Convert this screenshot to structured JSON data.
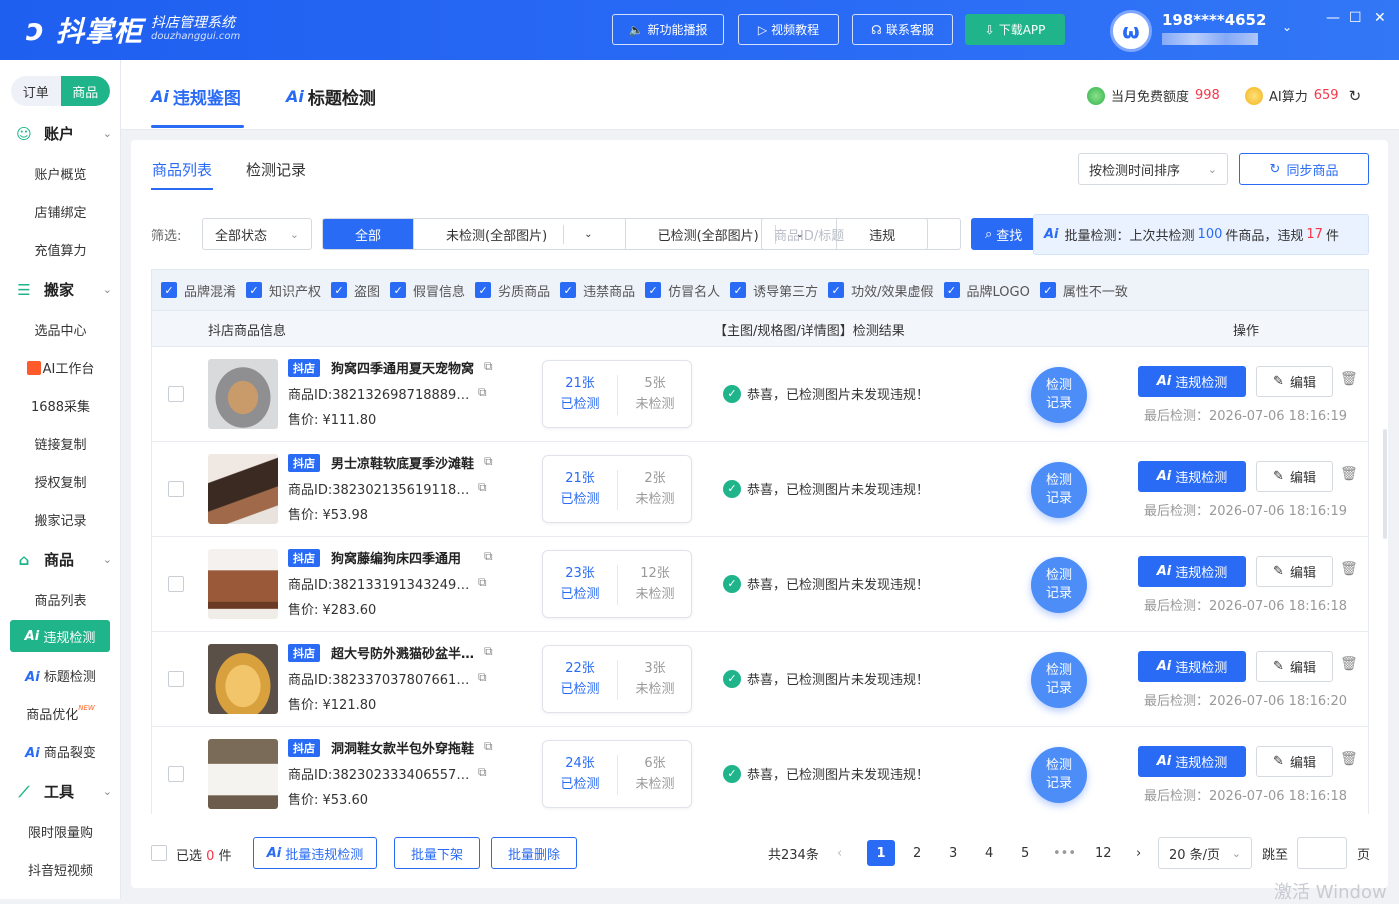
{
  "header": {
    "logo_name": "抖掌柜",
    "logo_sub": "抖店管理系统",
    "logo_domain": "douzhanggui.com",
    "buttons": [
      {
        "label": "新功能播报",
        "icon": "speaker-icon"
      },
      {
        "label": "视频教程",
        "icon": "video-icon"
      },
      {
        "label": "联系客服",
        "icon": "headset-icon"
      },
      {
        "label": "下载APP",
        "icon": "download-icon"
      }
    ],
    "user_phone": "198****4652",
    "win_controls": [
      "—",
      "☐",
      "✕"
    ]
  },
  "sidebar": {
    "toggle": [
      "订单",
      "商品"
    ],
    "groups": [
      {
        "label": "账户",
        "icon": "smile-icon",
        "items": [
          "账户概览",
          "店铺绑定",
          "充值算力"
        ]
      },
      {
        "label": "搬家",
        "icon": "stack-icon",
        "items": [
          "选品中心",
          "AI工作台",
          "1688采集",
          "链接复制",
          "授权复制",
          "搬家记录"
        ]
      },
      {
        "label": "商品",
        "icon": "shop-icon",
        "items": [
          "商品列表",
          "违规检测",
          "标题检测",
          "商品优化",
          "商品裂变"
        ]
      },
      {
        "label": "工具",
        "icon": "chart-line-icon",
        "items": [
          "限时限量购",
          "抖音短视频"
        ]
      }
    ],
    "new_badge": "NEW",
    "ai_prefix": "Ai"
  },
  "main_tabs": [
    {
      "label": "违规鉴图",
      "prefix": "Ai"
    },
    {
      "label": "标题检测",
      "prefix": "Ai"
    }
  ],
  "quota": {
    "free_label": "当月免费额度",
    "free_value": "998",
    "ai_label": "AI算力",
    "ai_value": "659"
  },
  "subtabs": [
    "商品列表",
    "检测记录"
  ],
  "sort_select": "按检测时间排序",
  "sync_button": "同步商品",
  "filter": {
    "label": "筛选:",
    "status_select": "全部状态",
    "segments": [
      "全部",
      "未检测(全部图片)",
      "已检测(全部图片)",
      "违规"
    ],
    "search_placeholder": "商品ID/标题",
    "find_button": "查找"
  },
  "batch_info": {
    "prefix": "批量检测：上次共检测",
    "count": "100",
    "mid": "件商品，违规",
    "violations": "17",
    "suffix": "件"
  },
  "categories": [
    "品牌混淆",
    "知识产权",
    "盗图",
    "假冒信息",
    "劣质商品",
    "违禁商品",
    "仿冒名人",
    "诱导第三方",
    "功效/效果虚假",
    "品牌LOGO",
    "属性不一致"
  ],
  "table_header": {
    "info": "抖店商品信息",
    "result": "【主图/规格图/详情图】检测结果",
    "ops": "操作"
  },
  "rows": [
    {
      "tag": "抖店",
      "title": "狗窝四季通用夏天宠物窝",
      "id_label": "商品ID:",
      "id": "3821326987188896...",
      "price": "售价: ¥111.80",
      "detected": "21张",
      "detected_label": "已检测",
      "undetected": "5张",
      "undetected_label": "未检测",
      "result": "恭喜，已检测图片未发现违规！",
      "rec": "检测记录",
      "vbtn": "违规检测",
      "edit": "编辑",
      "last": "最后检测：2026-07-06 18:16:19"
    },
    {
      "tag": "抖店",
      "title": "男士凉鞋软底夏季沙滩鞋",
      "id_label": "商品ID:",
      "id": "3823021356191187...",
      "price": "售价: ¥53.98",
      "detected": "21张",
      "detected_label": "已检测",
      "undetected": "2张",
      "undetected_label": "未检测",
      "result": "恭喜，已检测图片未发现违规！",
      "rec": "检测记录",
      "vbtn": "违规检测",
      "edit": "编辑",
      "last": "最后检测：2026-07-06 18:16:19"
    },
    {
      "tag": "抖店",
      "title": "狗窝藤编狗床四季通用",
      "id_label": "商品ID:",
      "id": "3821331913432498...",
      "price": "售价: ¥283.60",
      "detected": "23张",
      "detected_label": "已检测",
      "undetected": "12张",
      "undetected_label": "未检测",
      "result": "恭喜，已检测图片未发现违规！",
      "rec": "检测记录",
      "vbtn": "违规检测",
      "edit": "编辑",
      "last": "最后检测：2026-07-06 18:16:18"
    },
    {
      "tag": "抖店",
      "title": "超大号防外溅猫砂盆半封闭",
      "id_label": "商品ID:",
      "id": "3823370378076619...",
      "price": "售价: ¥121.80",
      "detected": "22张",
      "detected_label": "已检测",
      "undetected": "3张",
      "undetected_label": "未检测",
      "result": "恭喜，已检测图片未发现违规！",
      "rec": "检测记录",
      "vbtn": "违规检测",
      "edit": "编辑",
      "last": "最后检测：2026-07-06 18:16:20"
    },
    {
      "tag": "抖店",
      "title": "洞洞鞋女款半包外穿拖鞋",
      "id_label": "商品ID:",
      "id": "3823023334065570...",
      "price": "售价: ¥53.60",
      "detected": "24张",
      "detected_label": "已检测",
      "undetected": "6张",
      "undetected_label": "未检测",
      "result": "恭喜，已检测图片未发现违规！",
      "rec": "检测记录",
      "vbtn": "违规检测",
      "edit": "编辑",
      "last": "最后检测：2026-07-06 18:16:18"
    }
  ],
  "footer": {
    "selected_prefix": "已选",
    "selected_count": "0",
    "selected_suffix": "件",
    "batch_violation": "批量违规检测",
    "batch_offshelf": "批量下架",
    "batch_delete": "批量删除",
    "total": "共234条",
    "pages": [
      "1",
      "2",
      "3",
      "4",
      "5",
      "•••",
      "12"
    ],
    "current_page": "1",
    "page_size": "20 条/页",
    "jump_label": "跳至",
    "page_unit": "页"
  },
  "watermark": "激活 Window",
  "colors": {
    "brand_blue": "#2a6bf5",
    "brand_green": "#1fb48a",
    "alert_red": "#f5374a"
  }
}
